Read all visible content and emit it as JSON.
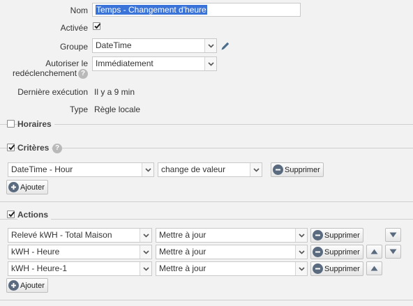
{
  "form": {
    "name": {
      "label": "Nom",
      "value": "Temps - Changement d'heure"
    },
    "enabled": {
      "label": "Activée",
      "checked": true
    },
    "group": {
      "label": "Groupe",
      "value": "DateTime"
    },
    "retrigger": {
      "label_line1": "Autoriser le",
      "label_line2": "redéclenchement",
      "value": "Immédiatement"
    },
    "last_run": {
      "label": "Dernière exécution",
      "value": "Il y a 9 min"
    },
    "type": {
      "label": "Type",
      "value": "Règle locale"
    }
  },
  "sections": {
    "schedules": {
      "title": "Horaires",
      "checked": false
    },
    "criteria": {
      "title": "Critères",
      "checked": true,
      "rows": [
        {
          "item": "DateTime - Hour",
          "condition": "change de valeur",
          "delete_label": "Supprimer"
        }
      ],
      "add_label": "Ajouter"
    },
    "actions": {
      "title": "Actions",
      "checked": true,
      "rows": [
        {
          "item": "Relevé kWH - Total Maison",
          "action": "Mettre à jour",
          "delete_label": "Supprimer"
        },
        {
          "item": "kWH - Heure",
          "action": "Mettre à jour",
          "delete_label": "Supprimer"
        },
        {
          "item": "kWH - Heure-1",
          "action": "Mettre à jour",
          "delete_label": "Supprimer"
        }
      ],
      "add_label": "Ajouter"
    }
  },
  "colors": {
    "background": "#f2f2f2",
    "selection": "#3a74d8",
    "button_icon": "#5a6b7f",
    "edit_icon": "#4a6d8c"
  },
  "icons": [
    "chevron-down-icon",
    "checkmark-icon",
    "help-icon",
    "pencil-icon",
    "minus-circle-icon",
    "plus-circle-icon",
    "arrow-up-icon",
    "arrow-down-icon"
  ]
}
